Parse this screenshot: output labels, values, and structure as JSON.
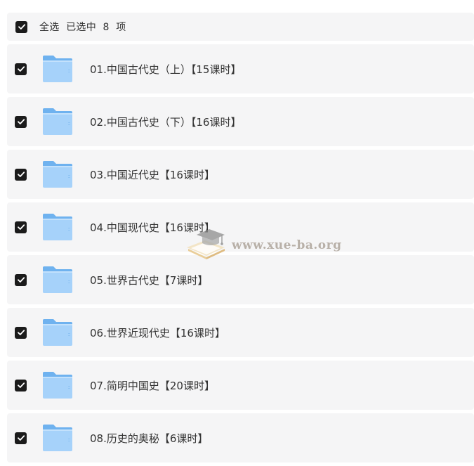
{
  "header": {
    "select_all_text": "全选  已选中  8  项"
  },
  "folders": [
    {
      "title": "01.中国古代史（上）【15课时】"
    },
    {
      "title": "02.中国古代史（下）【16课时】"
    },
    {
      "title": "03.中国近代史【16课时】"
    },
    {
      "title": "04.中国现代史【16课时】"
    },
    {
      "title": "05.世界古代史【7课时】"
    },
    {
      "title": "06.世界近现代史【16课时】"
    },
    {
      "title": "07.简明中国史【20课时】"
    },
    {
      "title": "08.历史的奥秘【6课时】"
    }
  ],
  "icons": {
    "checkbox": "checkbox-checked-icon",
    "folder": "folder-icon"
  },
  "colors": {
    "row_background": "#f5f5f6",
    "checkbox": "#1b1b1b",
    "folder_light": "#a6d2fa",
    "folder_dark": "#6fb2ef",
    "text": "#333333"
  },
  "watermark": {
    "text": "www.xue-ba.org"
  }
}
